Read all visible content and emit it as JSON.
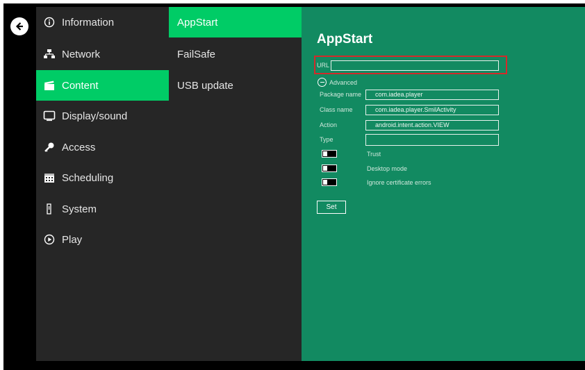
{
  "nav": {
    "items": [
      {
        "label": "Information",
        "icon": "info-icon"
      },
      {
        "label": "Network",
        "icon": "network-icon"
      },
      {
        "label": "Content",
        "icon": "clapperboard-icon",
        "active": true
      },
      {
        "label": "Display/sound",
        "icon": "monitor-icon"
      },
      {
        "label": "Access",
        "icon": "key-icon"
      },
      {
        "label": "Scheduling",
        "icon": "calendar-icon"
      },
      {
        "label": "System",
        "icon": "device-icon"
      },
      {
        "label": "Play",
        "icon": "play-icon"
      }
    ]
  },
  "subnav": {
    "items": [
      {
        "label": "AppStart",
        "active": true
      },
      {
        "label": "FailSafe"
      },
      {
        "label": "USB update"
      }
    ]
  },
  "panel": {
    "title": "AppStart",
    "url": {
      "label": "URL",
      "value": ""
    },
    "advanced_label": "Advanced",
    "fields": [
      {
        "label": "Package name",
        "value": "com.iadea.player"
      },
      {
        "label": "Class name",
        "value": "com.iadea.player.SmilActivity"
      },
      {
        "label": "Action",
        "value": "android.intent.action.VIEW"
      },
      {
        "label": "Type",
        "value": ""
      }
    ],
    "toggles": [
      {
        "label": "Trust"
      },
      {
        "label": "Desktop mode"
      },
      {
        "label": "Ignore certificate errors"
      }
    ],
    "set_label": "Set"
  },
  "colors": {
    "accent": "#00cc66",
    "panel_bg": "#128a61",
    "nav_bg": "#262626",
    "highlight": "#d32a2a"
  }
}
